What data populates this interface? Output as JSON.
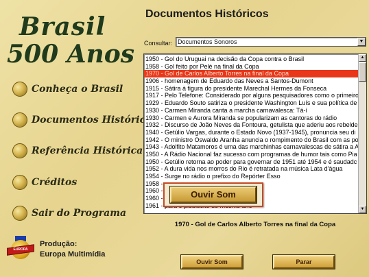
{
  "brand": {
    "line1": "Brasil",
    "line2": "500 Anos"
  },
  "menu": [
    {
      "label": "Conheça o Brasil"
    },
    {
      "label": "Documentos Históricos"
    },
    {
      "label": "Referência Histórica"
    },
    {
      "label": "Créditos"
    },
    {
      "label": "Sair do Programa"
    }
  ],
  "producer": {
    "line1": "Produção:",
    "line2": "Europa Multimídia",
    "logo_text": "EUROPA"
  },
  "main": {
    "title": "Documentos Históricos",
    "consult_label": "Consultar:",
    "consult_value": "Documentos Sonoros",
    "list": [
      "1950 - Gol do Uruguai na decisão da Copa contra o Brasil",
      "1958 - Gol feito por Pelé na final da Copa",
      "1970 - Gol de Carlos Alberto Torres na final da Copa",
      "1906 - homenagem de Eduardo das Neves a Santos-Dumont",
      "1915 - Sátira à figura do presidente Marechal Hermes da Fonseca",
      "1917 - Pelo Telefone: Considerado por alguns pesquisadores como o primeiro",
      "1929 - Eduardo Souto satiriza o presidente Washington Luís e sua política de",
      "1930 - Carmen Miranda canta a marcha carnavalesca: Tá-í",
      "1930 - Carmen e Aurora Miranda se popularizam as cantoras do rádio",
      "1932 - Discurso de João Neves da Fontoura, getulista que aderiu aos rebelde",
      "1940 - Getúlio Vargas, durante o Estado Novo (1937-1945), pronuncia seu di",
      "1942 - O ministro Oswaldo Aranha anuncia o rompimento do Brasil com as po",
      "1943 - Adolfito Matamoros é uma das marchinhas carnavalescas de sátira a A",
      "1950 - A Rádio Nacional faz sucesso com programas de humor tais como Pia",
      "1950 - Getúlio retorna ao poder para governar de 1951 até 1954 e é saudadc",
      "1952 - A dura vida nos morros do Rio é retratada na música Lata d'água",
      "1954 - Surge no rádio o prefixo do Repórter Esso",
      "1958 - ",
      "1960 - ",
      "1960 - os à presidência",
      "1961 - para o plebiscito do mesmo ano"
    ],
    "selected_index": 2,
    "popup_button": "Ouvir Som",
    "now_playing": "1970 - Gol de Carlos Alberto Torres na final da Copa",
    "play_button": "Ouvir Som",
    "stop_button": "Parar"
  }
}
